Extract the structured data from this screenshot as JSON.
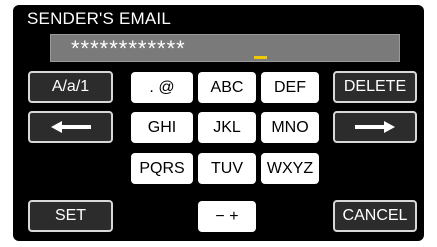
{
  "header": {
    "title": "SENDER'S EMAIL"
  },
  "entry": {
    "masked_value": "************"
  },
  "keyboard": {
    "mode_key": "A/a/1",
    "symbols_key": ". @",
    "abc_key": "ABC",
    "def_key": "DEF",
    "delete_key": "DELETE",
    "ghi_key": "GHI",
    "jkl_key": "JKL",
    "mno_key": "MNO",
    "pqrs_key": "PQRS",
    "tuv_key": "TUV",
    "wxyz_key": "WXYZ",
    "set_key": "SET",
    "minus_plus_key": "− +",
    "cancel_key": "CANCEL"
  },
  "icons": {
    "left": "left-arrow-icon",
    "right": "right-arrow-icon"
  },
  "colors": {
    "background": "#000000",
    "entry_field": "#7a7a7a",
    "cursor": "#f0c800",
    "key_light": "#ffffff",
    "key_dark": "#2c2c2c"
  }
}
